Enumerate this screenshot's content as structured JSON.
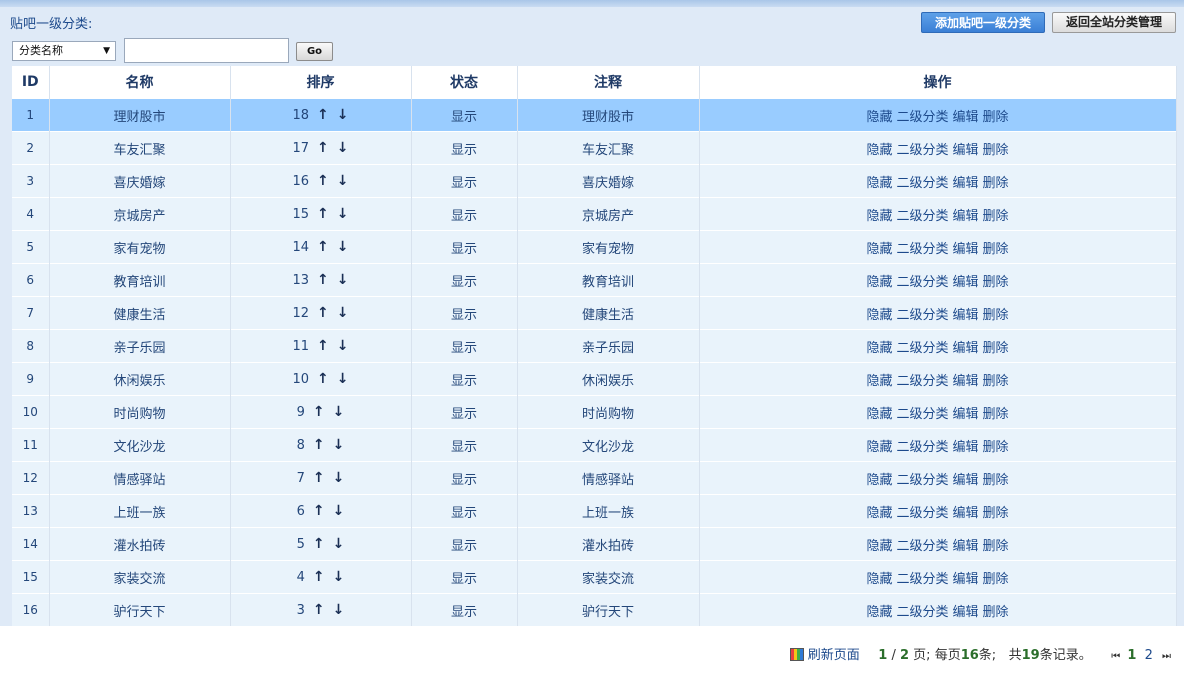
{
  "header": {
    "title": "贴吧一级分类:",
    "add_button": "添加贴吧一级分类",
    "back_button": "返回全站分类管理"
  },
  "search": {
    "select_value": "分类名称",
    "input_value": "",
    "go_label": "Go"
  },
  "table": {
    "headers": [
      "ID",
      "名称",
      "排序",
      "状态",
      "注释",
      "操作"
    ],
    "rows": [
      {
        "id": "1",
        "name": "理财股市",
        "order": "18",
        "status": "显示",
        "note": "理财股市"
      },
      {
        "id": "2",
        "name": "车友汇聚",
        "order": "17",
        "status": "显示",
        "note": "车友汇聚"
      },
      {
        "id": "3",
        "name": "喜庆婚嫁",
        "order": "16",
        "status": "显示",
        "note": "喜庆婚嫁"
      },
      {
        "id": "4",
        "name": "京城房产",
        "order": "15",
        "status": "显示",
        "note": "京城房产"
      },
      {
        "id": "5",
        "name": "家有宠物",
        "order": "14",
        "status": "显示",
        "note": "家有宠物"
      },
      {
        "id": "6",
        "name": "教育培训",
        "order": "13",
        "status": "显示",
        "note": "教育培训"
      },
      {
        "id": "7",
        "name": "健康生活",
        "order": "12",
        "status": "显示",
        "note": "健康生活"
      },
      {
        "id": "8",
        "name": "亲子乐园",
        "order": "11",
        "status": "显示",
        "note": "亲子乐园"
      },
      {
        "id": "9",
        "name": "休闲娱乐",
        "order": "10",
        "status": "显示",
        "note": "休闲娱乐"
      },
      {
        "id": "10",
        "name": "时尚购物",
        "order": "9",
        "status": "显示",
        "note": "时尚购物"
      },
      {
        "id": "11",
        "name": "文化沙龙",
        "order": "8",
        "status": "显示",
        "note": "文化沙龙"
      },
      {
        "id": "12",
        "name": "情感驿站",
        "order": "7",
        "status": "显示",
        "note": "情感驿站"
      },
      {
        "id": "13",
        "name": "上班一族",
        "order": "6",
        "status": "显示",
        "note": "上班一族"
      },
      {
        "id": "14",
        "name": "灌水拍砖",
        "order": "5",
        "status": "显示",
        "note": "灌水拍砖"
      },
      {
        "id": "15",
        "name": "家装交流",
        "order": "4",
        "status": "显示",
        "note": "家装交流"
      },
      {
        "id": "16",
        "name": "驴行天下",
        "order": "3",
        "status": "显示",
        "note": "驴行天下"
      }
    ],
    "selected_row_index": 0,
    "arrows": {
      "up": "↑",
      "down": "↓"
    },
    "actions": [
      "隐藏",
      "二级分类",
      "编辑",
      "删除"
    ]
  },
  "footer": {
    "refresh_label": "刷新页面",
    "current_page": "1",
    "page_sep": "/",
    "total_pages": "2",
    "page_unit": "页;",
    "per_page_prefix": "每页",
    "per_page": "16",
    "per_page_suffix": "条;",
    "total_prefix": "共",
    "total_records": "19",
    "total_suffix": "条记录。",
    "first_icon": "⏮",
    "last_icon": "⏭",
    "pages": [
      "1",
      "2"
    ]
  },
  "colors": {
    "selected_row": "#99ccff",
    "row_bg": "#e9f3fb",
    "add_button": "#3a7fd6"
  }
}
